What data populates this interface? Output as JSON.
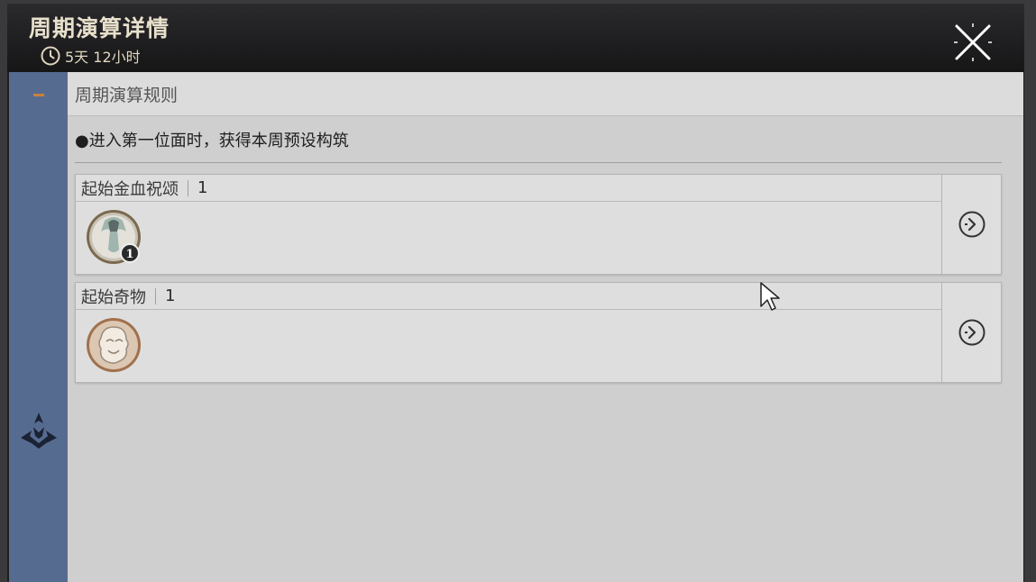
{
  "header": {
    "title": "周期演算详情",
    "timer": "5天 12小时",
    "timer_icon": "clock-icon",
    "close_icon": "close-icon"
  },
  "rules": {
    "title": "周期演算规则",
    "text": "●进入第一位面时，获得本周预设构筑"
  },
  "cards": [
    {
      "label": "起始金血祝颂",
      "count": "1",
      "item_badge": "1",
      "item_icon": "blessing-icon"
    },
    {
      "label": "起始奇物",
      "count": "1",
      "item_icon": "curio-icon"
    }
  ],
  "colors": {
    "sidebar": "#566b90",
    "header": "#1a1a1c",
    "panel": "#cfcfcf",
    "accent": "#c9823a"
  }
}
